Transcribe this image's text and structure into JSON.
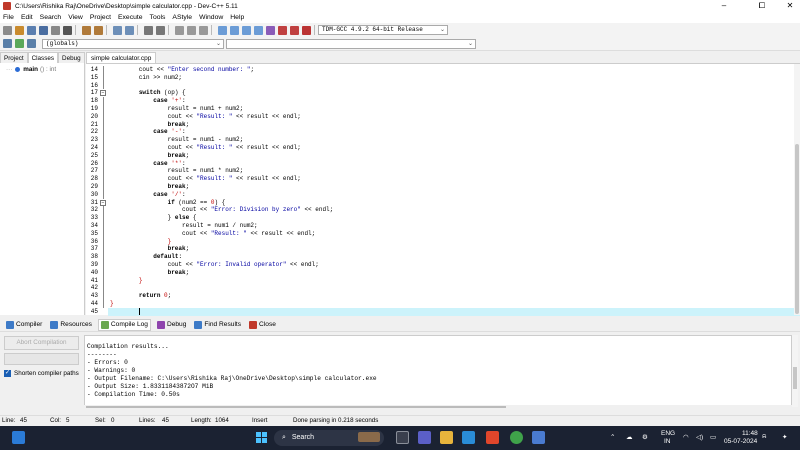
{
  "window": {
    "title": "C:\\Users\\Rishika Raj\\OneDrive\\Desktop\\simple calculator.cpp - Dev-C++ 5.11",
    "minimize": "–",
    "maximize": "⧠",
    "close": "✕"
  },
  "menu": [
    "File",
    "Edit",
    "Search",
    "View",
    "Project",
    "Execute",
    "Tools",
    "AStyle",
    "Window",
    "Help"
  ],
  "compiler_select": "TDM-GCC 4.9.2 64-bit Release",
  "globals_select": "(globals)",
  "left_tabs": [
    "Project",
    "Classes",
    "Debug"
  ],
  "class_tree": {
    "name": "main",
    "signature": "() : int"
  },
  "editor_tab": "simple calculator.cpp",
  "code_lines": [
    {
      "n": "14",
      "fold": "line",
      "html": "        cout &lt;&lt; <span class=\"str\">\"Enter second number: \"</span>;"
    },
    {
      "n": "15",
      "fold": "line",
      "html": "        cin &gt;&gt; num2;"
    },
    {
      "n": "16",
      "fold": "line",
      "html": ""
    },
    {
      "n": "17",
      "fold": "box",
      "html": "        <span class=\"kw\">switch</span> (op) {"
    },
    {
      "n": "18",
      "fold": "line",
      "html": "            <span class=\"kw\">case</span> <span class=\"num\">'+'</span>:"
    },
    {
      "n": "19",
      "fold": "line",
      "html": "                result = num1 + num2;"
    },
    {
      "n": "20",
      "fold": "line",
      "html": "                cout &lt;&lt; <span class=\"str\">\"Result: \"</span> &lt;&lt; result &lt;&lt; endl;"
    },
    {
      "n": "21",
      "fold": "line",
      "html": "                <span class=\"kw\">break</span>;"
    },
    {
      "n": "22",
      "fold": "line",
      "html": "            <span class=\"kw\">case</span> <span class=\"num\">'-'</span>:"
    },
    {
      "n": "23",
      "fold": "line",
      "html": "                result = num1 - num2;"
    },
    {
      "n": "24",
      "fold": "line",
      "html": "                cout &lt;&lt; <span class=\"str\">\"Result: \"</span> &lt;&lt; result &lt;&lt; endl;"
    },
    {
      "n": "25",
      "fold": "line",
      "html": "                <span class=\"kw\">break</span>;"
    },
    {
      "n": "26",
      "fold": "line",
      "html": "            <span class=\"kw\">case</span> <span class=\"num\">'*'</span>:"
    },
    {
      "n": "27",
      "fold": "line",
      "html": "                result = num1 * num2;"
    },
    {
      "n": "28",
      "fold": "line",
      "html": "                cout &lt;&lt; <span class=\"str\">\"Result: \"</span> &lt;&lt; result &lt;&lt; endl;"
    },
    {
      "n": "29",
      "fold": "line",
      "html": "                <span class=\"kw\">break</span>;"
    },
    {
      "n": "30",
      "fold": "line",
      "html": "            <span class=\"kw\">case</span> <span class=\"num\">'/'</span>:"
    },
    {
      "n": "31",
      "fold": "box",
      "html": "                <span class=\"kw\">if</span> (num2 == <span class=\"num\">0</span>) {"
    },
    {
      "n": "32",
      "fold": "line",
      "html": "                    cout &lt;&lt; <span class=\"str\">\"Error: Division by zero\"</span> &lt;&lt; endl;"
    },
    {
      "n": "33",
      "fold": "line",
      "html": "                } <span class=\"kw\">else</span> {"
    },
    {
      "n": "34",
      "fold": "line",
      "html": "                    result = num1 / num2;"
    },
    {
      "n": "35",
      "fold": "line",
      "html": "                    cout &lt;&lt; <span class=\"str\">\"Result: \"</span> &lt;&lt; result &lt;&lt; endl;"
    },
    {
      "n": "36",
      "fold": "line",
      "html": "                <span class=\"op\">}</span>"
    },
    {
      "n": "37",
      "fold": "line",
      "html": "                <span class=\"kw\">break</span>;"
    },
    {
      "n": "38",
      "fold": "line",
      "html": "            <span class=\"kw\">default</span>:"
    },
    {
      "n": "39",
      "fold": "line",
      "html": "                cout &lt;&lt; <span class=\"str\">\"Error: Invalid operator\"</span> &lt;&lt; endl;"
    },
    {
      "n": "40",
      "fold": "line",
      "html": "                <span class=\"kw\">break</span>;"
    },
    {
      "n": "41",
      "fold": "line",
      "html": "        <span class=\"op\">}</span>"
    },
    {
      "n": "42",
      "fold": "line",
      "html": ""
    },
    {
      "n": "43",
      "fold": "line",
      "html": "        <span class=\"kw\">return</span> <span class=\"num\">0</span>;"
    },
    {
      "n": "44",
      "fold": "line",
      "html": "<span class=\"op\">}</span>"
    },
    {
      "n": "45",
      "fold": "none",
      "html": ""
    }
  ],
  "bottom_tabs": [
    "Compiler",
    "Resources",
    "Compile Log",
    "Debug",
    "Find Results",
    "Close"
  ],
  "abort_label": "Abort Compilation",
  "shorten_label": "Shorten compiler paths",
  "log_text": "Compilation results...\n--------\n- Errors: 0\n- Warnings: 0\n- Output Filename: C:\\Users\\Rishika Raj\\OneDrive\\Desktop\\simple calculator.exe\n- Output Size: 1.83311843872O7 MiB\n- Compilation Time: 0.50s",
  "status": {
    "line_label": "Line:",
    "line": "45",
    "col_label": "Col:",
    "col": "5",
    "sel_label": "Sel:",
    "sel": "0",
    "lines_label": "Lines:",
    "lines": "45",
    "length_label": "Length:",
    "length": "1064",
    "mode": "Insert",
    "message": "Done parsing in 0.218 seconds"
  },
  "taskbar": {
    "search": "Search",
    "lang1": "ENG",
    "lang2": "IN",
    "time": "11:48",
    "date": "05-07-2024"
  },
  "colors": {
    "accent": "#4cc2ff",
    "current_line": "#ccf3fb",
    "string": "#0000a0",
    "number": "#c00000"
  }
}
